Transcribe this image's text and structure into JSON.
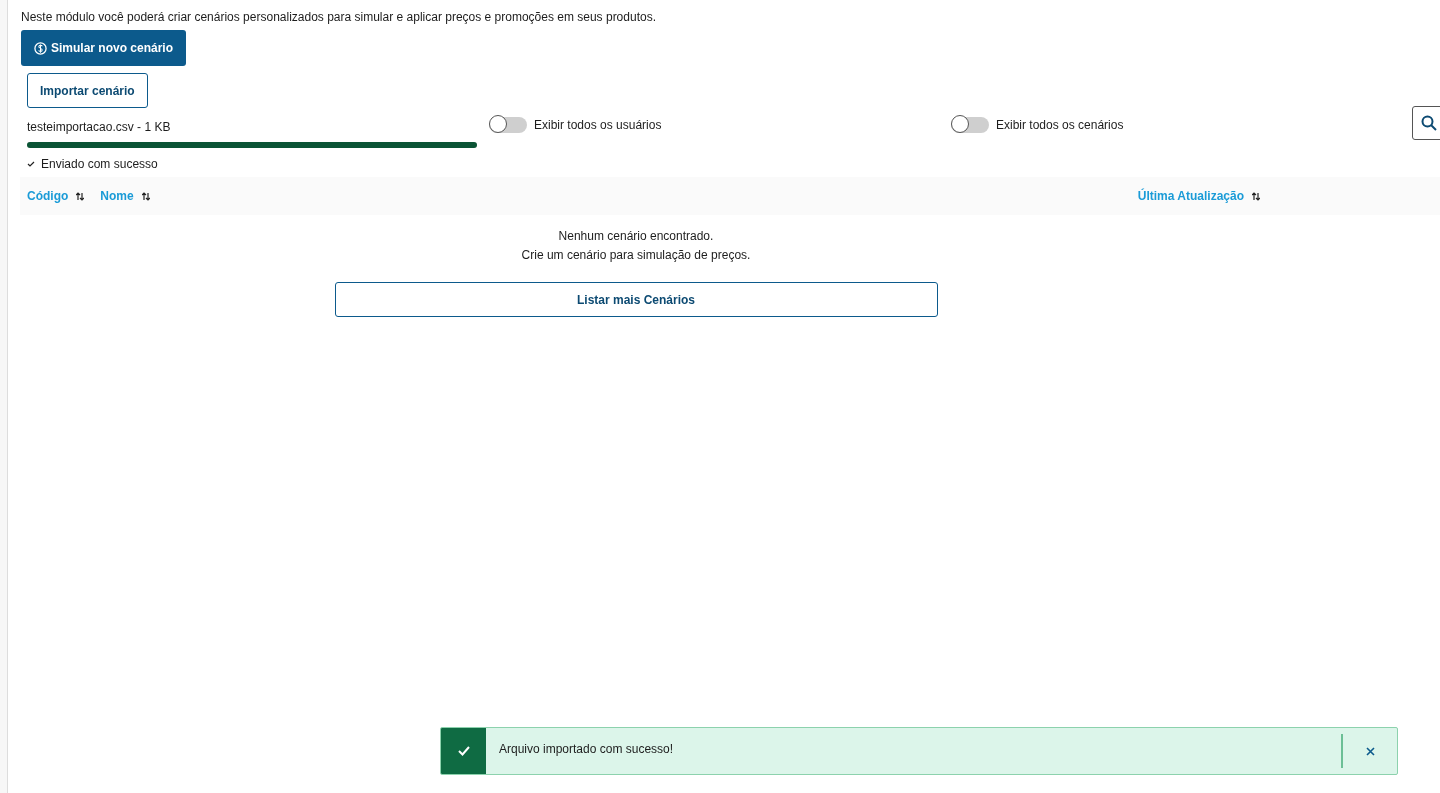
{
  "description": "Neste módulo você poderá criar cenários personalizados para simular e aplicar preços e promoções em seus produtos.",
  "primary_button": "Simular novo cenário",
  "import_button": "Importar cenário",
  "upload": {
    "file": "testeimportacao.csv - 1 KB",
    "level": 1,
    "status": "Enviado com sucesso"
  },
  "toggles": [
    {
      "label": "Exibir todos os usuários",
      "on": false
    },
    {
      "label": "Exibir todos os cenários",
      "on": false
    }
  ],
  "table": {
    "columns": [
      {
        "label": "Código"
      },
      {
        "label": "Nome"
      },
      {
        "label": "Última Atualização"
      }
    ],
    "empty": [
      "Nenhum cenário encontrado.",
      "Crie um cenário para simulação de preços."
    ],
    "more_button": "Listar mais Cenários"
  },
  "toast": {
    "message": "Arquivo importado com sucesso!"
  }
}
